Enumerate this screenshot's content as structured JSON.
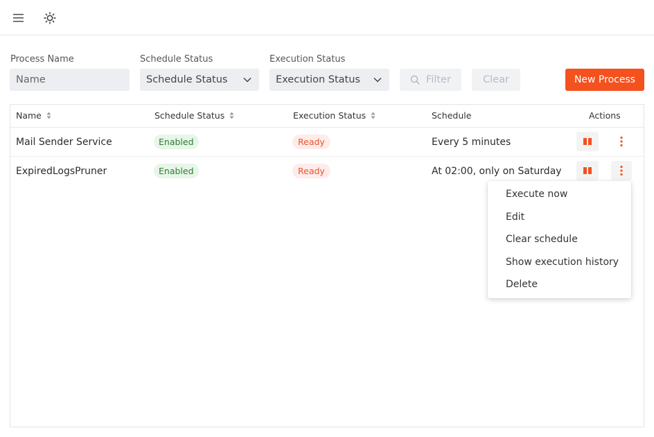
{
  "topbar": {
    "menu_icon": "hamburger-icon",
    "theme_icon": "sun-icon"
  },
  "filters": {
    "process_name": {
      "label": "Process Name",
      "placeholder": "Name",
      "value": ""
    },
    "schedule_status": {
      "label": "Schedule Status",
      "value": "Schedule Status"
    },
    "execution_status": {
      "label": "Execution Status",
      "value": "Execution Status"
    },
    "filter_button": "Filter",
    "clear_button": "Clear",
    "new_process_button": "New Process"
  },
  "table": {
    "columns": [
      "Name",
      "Schedule Status",
      "Execution Status",
      "Schedule",
      "Actions"
    ],
    "rows": [
      {
        "name": "Mail Sender Service",
        "schedule_status": "Enabled",
        "execution_status": "Ready",
        "schedule": "Every 5 minutes"
      },
      {
        "name": "ExpiredLogsPruner",
        "schedule_status": "Enabled",
        "execution_status": "Ready",
        "schedule": "At 02:00, only on Saturday"
      }
    ]
  },
  "context_menu": {
    "items": [
      "Execute now",
      "Edit",
      "Clear schedule",
      "Show execution history",
      "Delete"
    ]
  },
  "colors": {
    "accent": "#f4511e",
    "enabled_bg": "#e8f5e9",
    "enabled_text": "#2e7d32",
    "ready_bg": "#fdecea",
    "ready_text": "#e8552e"
  }
}
